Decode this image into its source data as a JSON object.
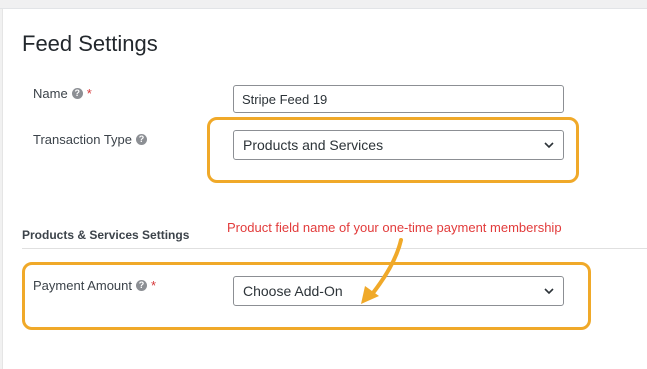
{
  "feed_settings": {
    "title": "Feed Settings",
    "name_label": "Name",
    "name_value": "Stripe Feed 19",
    "required_mark": "*",
    "transaction_type_label": "Transaction Type",
    "transaction_type_value": "Products and Services"
  },
  "products_services": {
    "heading": "Products & Services Settings",
    "payment_amount_label": "Payment Amount",
    "payment_amount_value": "Choose Add-On"
  },
  "annotation": {
    "text": "Product field name of your one-time payment membership",
    "color": "#e23b3b",
    "highlight_color": "#f0a929"
  },
  "icons": {
    "help": "?"
  }
}
